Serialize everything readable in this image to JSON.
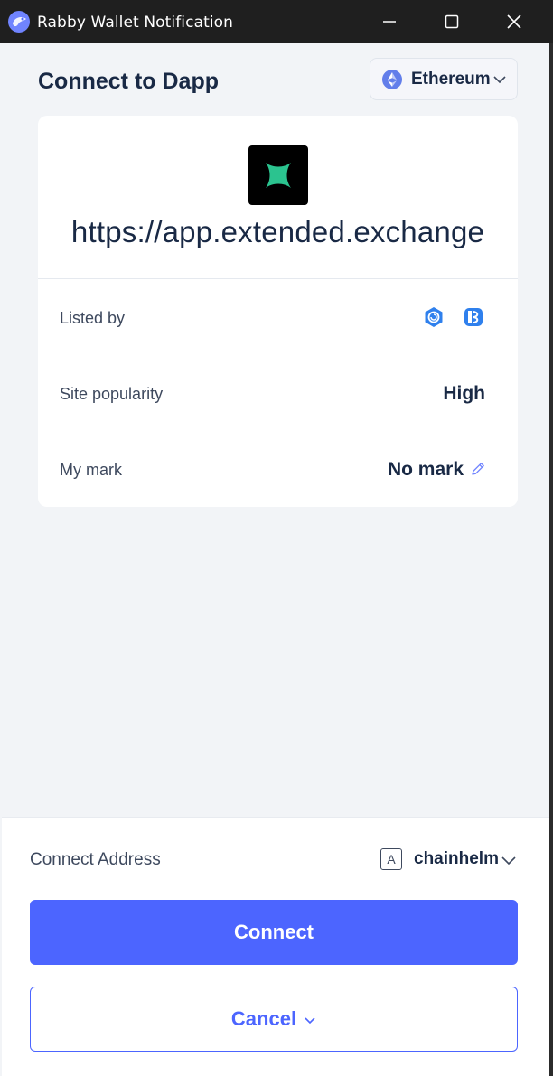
{
  "window": {
    "title": "Rabby Wallet Notification",
    "controls": [
      "minimize",
      "maximize",
      "close"
    ]
  },
  "header": {
    "title": "Connect to Dapp",
    "chain": {
      "name": "Ethereum",
      "icon": "ethereum-icon"
    }
  },
  "site": {
    "url": "https://app.extended.exchange",
    "logo_icon": "extended-logo-icon",
    "logo_color": "#2bc38f"
  },
  "info_rows": {
    "listed_by": {
      "label": "Listed by",
      "sources": [
        "defillama-icon",
        "rabby-listing-icon"
      ]
    },
    "popularity": {
      "label": "Site popularity",
      "value": "High"
    },
    "mark": {
      "label": "My mark",
      "value": "No mark"
    }
  },
  "footer": {
    "address_label": "Connect Address",
    "address_badge": "A",
    "address_name": "chainhelm",
    "connect_label": "Connect",
    "cancel_label": "Cancel"
  },
  "colors": {
    "accent": "#4c65ff",
    "titlebar": "#1f1f1f",
    "background": "#f2f4f7",
    "text": "#192945"
  }
}
